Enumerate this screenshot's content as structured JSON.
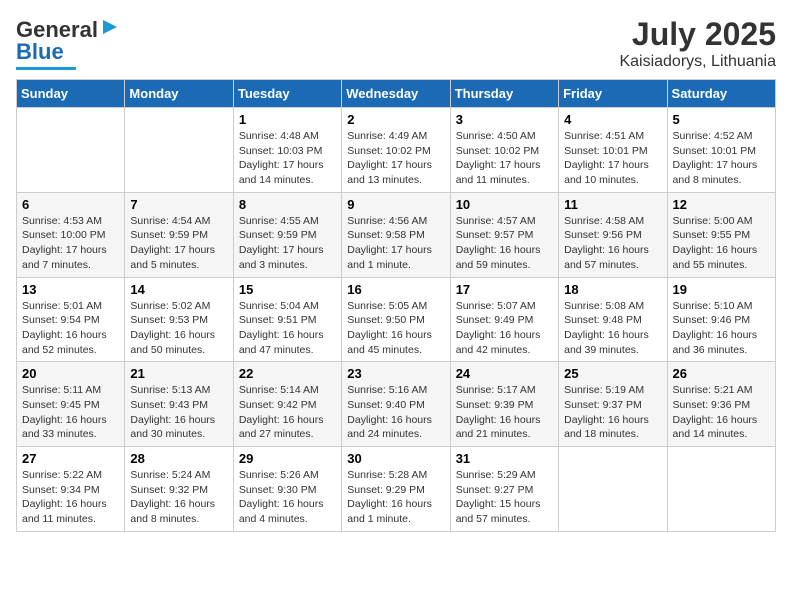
{
  "header": {
    "logo_general": "General",
    "logo_blue": "Blue",
    "month_title": "July 2025",
    "location": "Kaisiadorys, Lithuania"
  },
  "days_of_week": [
    "Sunday",
    "Monday",
    "Tuesday",
    "Wednesday",
    "Thursday",
    "Friday",
    "Saturday"
  ],
  "weeks": [
    [
      {
        "day": "",
        "info": ""
      },
      {
        "day": "",
        "info": ""
      },
      {
        "day": "1",
        "info": "Sunrise: 4:48 AM\nSunset: 10:03 PM\nDaylight: 17 hours and 14 minutes."
      },
      {
        "day": "2",
        "info": "Sunrise: 4:49 AM\nSunset: 10:02 PM\nDaylight: 17 hours and 13 minutes."
      },
      {
        "day": "3",
        "info": "Sunrise: 4:50 AM\nSunset: 10:02 PM\nDaylight: 17 hours and 11 minutes."
      },
      {
        "day": "4",
        "info": "Sunrise: 4:51 AM\nSunset: 10:01 PM\nDaylight: 17 hours and 10 minutes."
      },
      {
        "day": "5",
        "info": "Sunrise: 4:52 AM\nSunset: 10:01 PM\nDaylight: 17 hours and 8 minutes."
      }
    ],
    [
      {
        "day": "6",
        "info": "Sunrise: 4:53 AM\nSunset: 10:00 PM\nDaylight: 17 hours and 7 minutes."
      },
      {
        "day": "7",
        "info": "Sunrise: 4:54 AM\nSunset: 9:59 PM\nDaylight: 17 hours and 5 minutes."
      },
      {
        "day": "8",
        "info": "Sunrise: 4:55 AM\nSunset: 9:59 PM\nDaylight: 17 hours and 3 minutes."
      },
      {
        "day": "9",
        "info": "Sunrise: 4:56 AM\nSunset: 9:58 PM\nDaylight: 17 hours and 1 minute."
      },
      {
        "day": "10",
        "info": "Sunrise: 4:57 AM\nSunset: 9:57 PM\nDaylight: 16 hours and 59 minutes."
      },
      {
        "day": "11",
        "info": "Sunrise: 4:58 AM\nSunset: 9:56 PM\nDaylight: 16 hours and 57 minutes."
      },
      {
        "day": "12",
        "info": "Sunrise: 5:00 AM\nSunset: 9:55 PM\nDaylight: 16 hours and 55 minutes."
      }
    ],
    [
      {
        "day": "13",
        "info": "Sunrise: 5:01 AM\nSunset: 9:54 PM\nDaylight: 16 hours and 52 minutes."
      },
      {
        "day": "14",
        "info": "Sunrise: 5:02 AM\nSunset: 9:53 PM\nDaylight: 16 hours and 50 minutes."
      },
      {
        "day": "15",
        "info": "Sunrise: 5:04 AM\nSunset: 9:51 PM\nDaylight: 16 hours and 47 minutes."
      },
      {
        "day": "16",
        "info": "Sunrise: 5:05 AM\nSunset: 9:50 PM\nDaylight: 16 hours and 45 minutes."
      },
      {
        "day": "17",
        "info": "Sunrise: 5:07 AM\nSunset: 9:49 PM\nDaylight: 16 hours and 42 minutes."
      },
      {
        "day": "18",
        "info": "Sunrise: 5:08 AM\nSunset: 9:48 PM\nDaylight: 16 hours and 39 minutes."
      },
      {
        "day": "19",
        "info": "Sunrise: 5:10 AM\nSunset: 9:46 PM\nDaylight: 16 hours and 36 minutes."
      }
    ],
    [
      {
        "day": "20",
        "info": "Sunrise: 5:11 AM\nSunset: 9:45 PM\nDaylight: 16 hours and 33 minutes."
      },
      {
        "day": "21",
        "info": "Sunrise: 5:13 AM\nSunset: 9:43 PM\nDaylight: 16 hours and 30 minutes."
      },
      {
        "day": "22",
        "info": "Sunrise: 5:14 AM\nSunset: 9:42 PM\nDaylight: 16 hours and 27 minutes."
      },
      {
        "day": "23",
        "info": "Sunrise: 5:16 AM\nSunset: 9:40 PM\nDaylight: 16 hours and 24 minutes."
      },
      {
        "day": "24",
        "info": "Sunrise: 5:17 AM\nSunset: 9:39 PM\nDaylight: 16 hours and 21 minutes."
      },
      {
        "day": "25",
        "info": "Sunrise: 5:19 AM\nSunset: 9:37 PM\nDaylight: 16 hours and 18 minutes."
      },
      {
        "day": "26",
        "info": "Sunrise: 5:21 AM\nSunset: 9:36 PM\nDaylight: 16 hours and 14 minutes."
      }
    ],
    [
      {
        "day": "27",
        "info": "Sunrise: 5:22 AM\nSunset: 9:34 PM\nDaylight: 16 hours and 11 minutes."
      },
      {
        "day": "28",
        "info": "Sunrise: 5:24 AM\nSunset: 9:32 PM\nDaylight: 16 hours and 8 minutes."
      },
      {
        "day": "29",
        "info": "Sunrise: 5:26 AM\nSunset: 9:30 PM\nDaylight: 16 hours and 4 minutes."
      },
      {
        "day": "30",
        "info": "Sunrise: 5:28 AM\nSunset: 9:29 PM\nDaylight: 16 hours and 1 minute."
      },
      {
        "day": "31",
        "info": "Sunrise: 5:29 AM\nSunset: 9:27 PM\nDaylight: 15 hours and 57 minutes."
      },
      {
        "day": "",
        "info": ""
      },
      {
        "day": "",
        "info": ""
      }
    ]
  ]
}
